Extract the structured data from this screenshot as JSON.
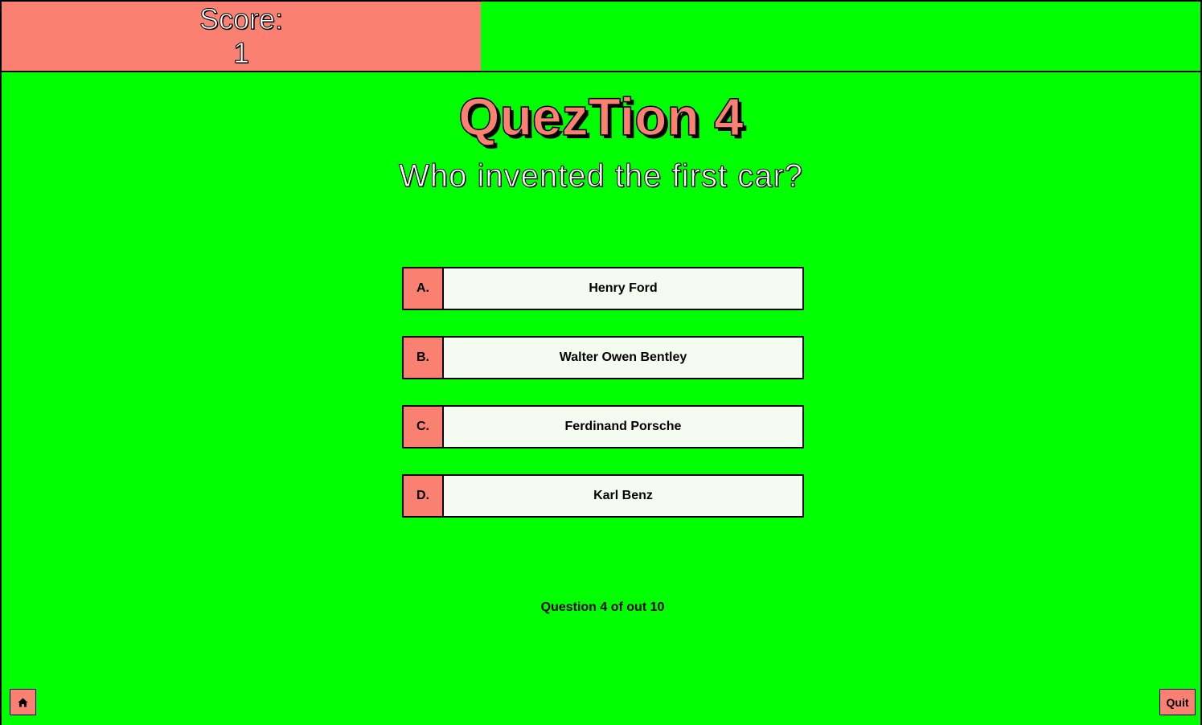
{
  "header": {
    "score_label": "Score:",
    "score_value": "1"
  },
  "quiz": {
    "title": "QuezTion 4",
    "question": "Who invented the first car?",
    "answers": [
      {
        "letter": "A.",
        "text": "Henry Ford"
      },
      {
        "letter": "B.",
        "text": "Walter Owen Bentley"
      },
      {
        "letter": "C.",
        "text": "Ferdinand Porsche"
      },
      {
        "letter": "D.",
        "text": "Karl Benz"
      }
    ],
    "progress": "Question 4 of out 10"
  },
  "footer": {
    "home_icon": "home-icon",
    "quit_label": "Quit"
  },
  "colors": {
    "background": "#00ff00",
    "accent": "#fa8072",
    "answer_bg": "#f5fbf0"
  }
}
